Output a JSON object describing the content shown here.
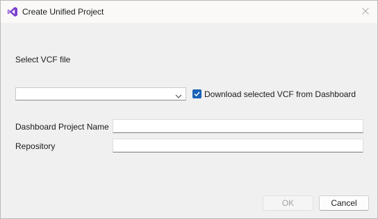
{
  "window": {
    "title": "Create Unified Project",
    "app_icon": "visual-studio-icon",
    "close_icon": "close-icon"
  },
  "form": {
    "vcf_label": "Select VCF file",
    "vcf_selected_value": "",
    "download_checkbox_label": "Download selected VCF from Dashboard",
    "download_checkbox_checked": true,
    "project_name_label": "Dashboard Project Name",
    "project_name_value": "",
    "repository_label": "Repository",
    "repository_value": ""
  },
  "buttons": {
    "ok_label": "OK",
    "ok_enabled": false,
    "cancel_label": "Cancel"
  },
  "colors": {
    "accent": "#1a62b8",
    "icon_purple": "#7b3fd0",
    "window_bg": "#f0f0f0"
  }
}
